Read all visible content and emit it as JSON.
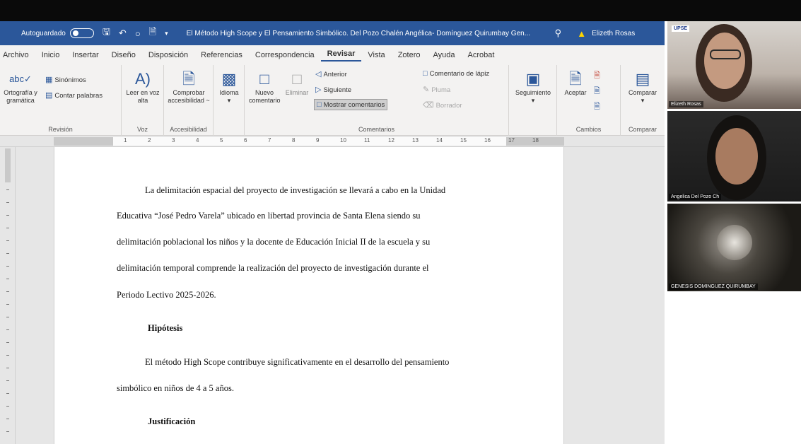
{
  "titlebar": {
    "autosave_label": "Autoguardado",
    "doc_title": "El Método High Scope y El Pensamiento Simbólico. Del Pozo Chalén Angélica- Domínguez Quirumbay Gen...",
    "user_name": "Elizeth Rosas"
  },
  "ribbon": {
    "tabs": [
      "Archivo",
      "Inicio",
      "Insertar",
      "Diseño",
      "Disposición",
      "Referencias",
      "Correspondencia",
      "Revisar",
      "Vista",
      "Zotero",
      "Ayuda",
      "Acrobat"
    ],
    "active_tab": "Revisar",
    "groups": {
      "revision": {
        "label": "Revisión",
        "spelling": "Ortografía y gramática",
        "synonyms": "Sinónimos",
        "word_count": "Contar palabras"
      },
      "voz": {
        "label": "Voz",
        "read_aloud": "Leer en voz alta"
      },
      "accesibilidad": {
        "label": "Accesibilidad",
        "check": "Comprobar accesibilidad ~"
      },
      "idioma": {
        "label": "Idioma"
      },
      "comentarios": {
        "label": "Comentarios",
        "new_comment": "Nuevo comentario",
        "delete": "Eliminar",
        "previous": "Anterior",
        "next": "Siguiente",
        "show_comments": "Mostrar comentarios",
        "ink_comment": "Comentario de lápiz",
        "pen": "Pluma",
        "eraser": "Borrador"
      },
      "seguimiento": {
        "label": "Seguimiento"
      },
      "cambios": {
        "label": "Cambios",
        "accept": "Aceptar"
      },
      "comparar": {
        "label": "Comparar",
        "compare": "Comparar"
      }
    }
  },
  "ruler_numbers": [
    "1",
    "2",
    "3",
    "4",
    "5",
    "6",
    "7",
    "8",
    "9",
    "10",
    "11",
    "12",
    "13",
    "14",
    "15",
    "16",
    "17",
    "18"
  ],
  "document": {
    "para1_lines": [
      "La delimitación espacial del proyecto de investigación se llevará a cabo en la Unidad",
      "Educativa “José Pedro Varela” ubicado en libertad provincia de Santa Elena siendo su",
      "delimitación poblacional los niños y la docente de Educación Inicial II de la escuela y su",
      "delimitación temporal comprende la realización del proyecto de investigación durante el",
      "Periodo Lectivo 2025-2026."
    ],
    "heading_hipotesis": "Hipótesis",
    "para2_lines": [
      "El método High Scope contribuye significativamente en el desarrollo del pensamiento",
      "simbólico en niños de 4 a 5 años."
    ],
    "heading_justificacion": "Justificación"
  },
  "participants": [
    {
      "name": "Elizeth Rosas"
    },
    {
      "name": "Angelica Del Pozo Ch"
    },
    {
      "name": "GENESIS DOMINGUEZ QUIRUMBAY"
    }
  ],
  "video_logo": "UPSE",
  "colors": {
    "word_blue": "#2b579a",
    "ribbon_bg": "#f3f2f1"
  }
}
